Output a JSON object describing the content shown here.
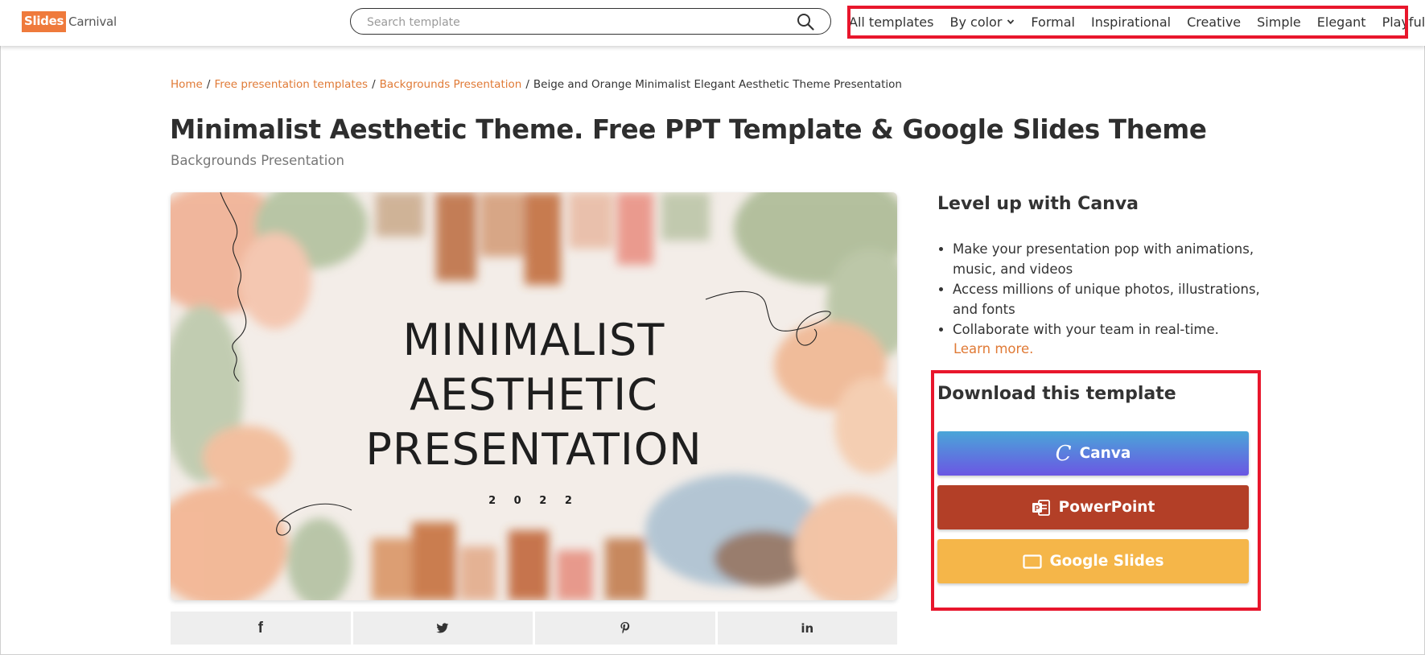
{
  "header": {
    "logo": {
      "part1": "Slides",
      "part2": "Carnival"
    },
    "search": {
      "placeholder": "Search template",
      "value": ""
    },
    "nav": [
      {
        "label": "All templates"
      },
      {
        "label": "By color",
        "has_dropdown": true
      },
      {
        "label": "Formal"
      },
      {
        "label": "Inspirational"
      },
      {
        "label": "Creative"
      },
      {
        "label": "Simple"
      },
      {
        "label": "Elegant"
      },
      {
        "label": "Playful"
      }
    ]
  },
  "breadcrumb": {
    "items": [
      "Home",
      "Free presentation templates",
      "Backgrounds Presentation"
    ],
    "separator": "/",
    "current": "Beige and Orange Minimalist Elegant Aesthetic Theme Presentation"
  },
  "page": {
    "title": "Minimalist Aesthetic Theme. Free PPT Template & Google Slides Theme",
    "subtitle": "Backgrounds Presentation"
  },
  "preview": {
    "lines": [
      "MINIMALIST",
      "AESTHETIC",
      "PRESENTATION"
    ],
    "year": "2 0 2 2"
  },
  "share": [
    {
      "label": "f",
      "icon": "facebook-icon"
    },
    {
      "label": "",
      "icon": "twitter-icon"
    },
    {
      "label": "",
      "icon": "pinterest-icon"
    },
    {
      "label": "in",
      "icon": "linkedin-icon"
    }
  ],
  "sidebar": {
    "canva_heading": "Level up with Canva",
    "features": [
      "Make your presentation pop with animations, music, and videos",
      "Access millions of unique photos, illustrations, and fonts",
      "Collaborate with your team in real-time."
    ],
    "learn_more": "Learn more.",
    "download_heading": "Download this template",
    "buttons": {
      "canva": "Canva",
      "powerpoint": "PowerPoint",
      "google_slides": "Google Slides"
    }
  },
  "colors": {
    "accent": "#e07a36",
    "highlight": "#e8162c",
    "canva_top": "#4aa6d8",
    "canva_bottom": "#6b56e3",
    "powerpoint": "#b33f27",
    "google_slides": "#f5b649"
  }
}
